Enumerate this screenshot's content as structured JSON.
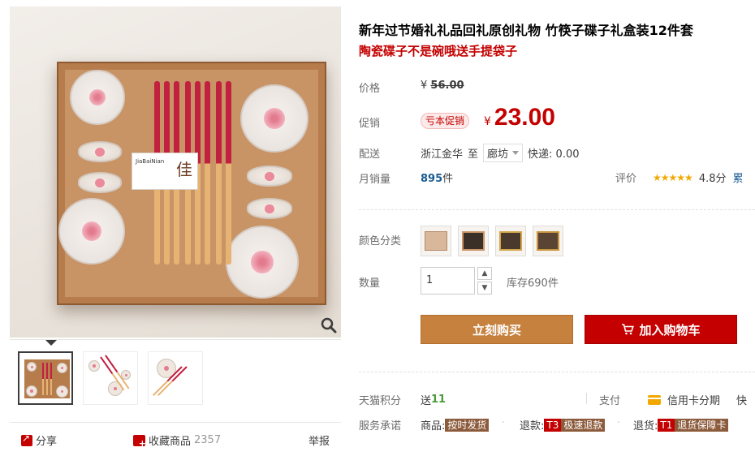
{
  "product": {
    "title": "新年过节婚礼礼品回礼原创礼物 竹筷子碟子礼盒装12件套",
    "subtitle": "陶瓷碟子不是碗哦送手提袋子",
    "photo_brand": "JiaBaiNian",
    "photo_char": "佳"
  },
  "price": {
    "label": "价格",
    "currency": "¥",
    "original": "56.00",
    "promo_label": "促销",
    "promo_tag": "亏本促销",
    "promo_value": "23.00"
  },
  "shipping": {
    "label": "配送",
    "from": "浙江金华",
    "to_word": "至",
    "destination": "廊坊",
    "fee": "快递: 0.00"
  },
  "sales": {
    "label": "月销量",
    "count": "895",
    "unit": "件",
    "rating_label": "评价",
    "stars": "★★★★★",
    "score": "4.8分",
    "more": "累"
  },
  "options": {
    "color_label": "颜色分类",
    "qty_label": "数量",
    "qty_value": "1",
    "stock": "库存690件"
  },
  "actions": {
    "buy": "立刻购买",
    "cart": "加入购物车"
  },
  "extras": {
    "points_label": "天猫积分",
    "points_prefix": "送",
    "points_value": "11",
    "pay_label": "支付",
    "pay_credit": "信用卡分期",
    "pay_more": "快",
    "service_label": "服务承诺",
    "svc1_prefix": "商品:",
    "svc1_tag": "按时发货",
    "svc2_prefix": "退款:",
    "svc2_code": "T3",
    "svc2_tag": "极速退款",
    "svc3_prefix": "退货:",
    "svc3_code": "T1",
    "svc3_tag": "退货保障卡"
  },
  "gallery": {
    "share": "分享",
    "favorite": "收藏商品",
    "favorite_count": "2357",
    "report": "举报"
  },
  "colors": {
    "accent": "#c40000",
    "buy_button": "#c7813f",
    "link": "#1d5c92",
    "stars": "#f2a800"
  }
}
